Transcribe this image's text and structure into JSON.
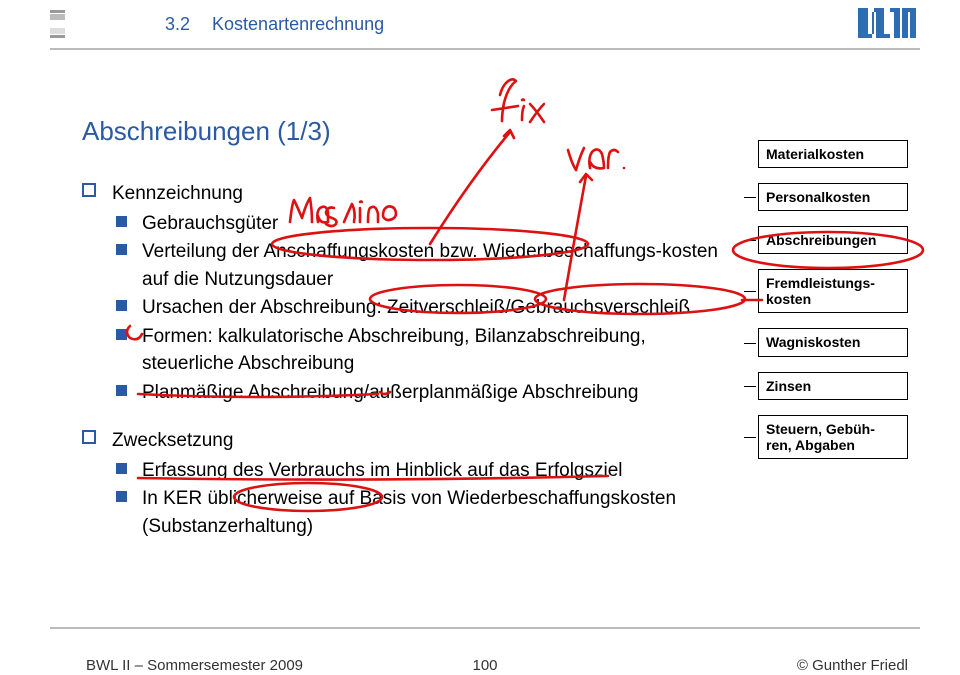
{
  "header": {
    "chapter_num": "3.2",
    "chapter_title": "Kostenartenrechnung"
  },
  "title": "Abschreibungen (1/3)",
  "section1": {
    "heading": "Kennzeichnung",
    "items": {
      "g": "Gebrauchsgüter",
      "v": "Verteilung der Anschaffungskosten bzw. Wiederbeschaffungs-kosten auf die Nutzungsdauer",
      "u": "Ursachen der Abschreibung: Zeitverschleiß/Gebrauchsverschleiß",
      "f": "Formen: kalkulatorische Abschreibung, Bilanzabschreibung, steuerliche Abschreibung",
      "p": "Planmäßige Abschreibung/außerplanmäßige Abschreibung"
    }
  },
  "section2": {
    "heading": "Zwecksetzung",
    "items": {
      "e": "Erfassung des Verbrauchs im Hinblick auf das Erfolgsziel",
      "k": "In KER üblicherweise auf Basis von Wiederbeschaffungskosten (Substanzerhaltung)"
    }
  },
  "sideboxes": {
    "b0": "Materialkosten",
    "b1": "Personalkosten",
    "b2": "Abschreibungen",
    "b3": "Fremdleistungs-kosten",
    "b4": "Wagniskosten",
    "b5": "Zinsen",
    "b6": "Steuern, Gebüh-ren, Abgaben"
  },
  "annotations": {
    "fix": "fix",
    "var": "var.",
    "maschine": "Maschine"
  },
  "footer": {
    "left": "BWL II – Sommersemester 2009",
    "center": "100",
    "right": "© Gunther Friedl"
  },
  "icons": {
    "logo": "tum-logo"
  }
}
